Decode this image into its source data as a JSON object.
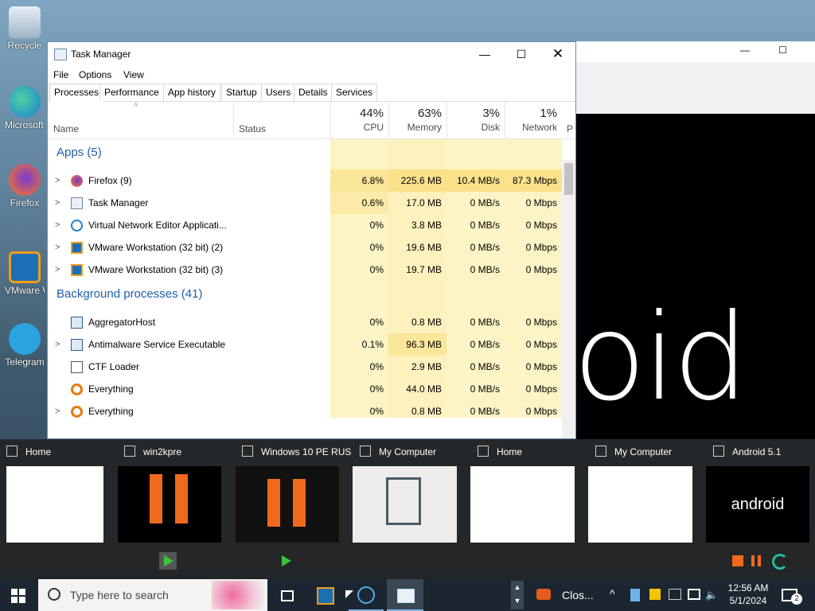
{
  "desktop": {
    "icons": [
      {
        "label": "Recycle"
      },
      {
        "label": "Microsoft Edge"
      },
      {
        "label": "Firefox"
      },
      {
        "label": "VMware Workstation"
      },
      {
        "label": "Telegram"
      }
    ]
  },
  "background_window": {
    "minimize": "—",
    "maximize": "☐",
    "big_text": "oid"
  },
  "task_manager": {
    "title": "Task Manager",
    "menu": [
      "File",
      "Options",
      "View"
    ],
    "tabs": [
      "Processes",
      "Performance",
      "App history",
      "Startup",
      "Users",
      "Details",
      "Services"
    ],
    "columns": {
      "name": "Name",
      "status": "Status",
      "cpu": {
        "pct": "44%",
        "label": "CPU"
      },
      "memory": {
        "pct": "63%",
        "label": "Memory"
      },
      "disk": {
        "pct": "3%",
        "label": "Disk"
      },
      "network": {
        "pct": "1%",
        "label": "Network"
      },
      "power": "P"
    },
    "apps_header": "Apps (5)",
    "apps": [
      {
        "name": "Firefox (9)",
        "cpu": "6.8%",
        "mem": "225.6 MB",
        "disk": "10.4 MB/s",
        "net": "87.3 Mbps"
      },
      {
        "name": "Task Manager",
        "cpu": "0.6%",
        "mem": "17.0 MB",
        "disk": "0 MB/s",
        "net": "0 Mbps"
      },
      {
        "name": "Virtual Network Editor Applicati...",
        "cpu": "0%",
        "mem": "3.8 MB",
        "disk": "0 MB/s",
        "net": "0 Mbps"
      },
      {
        "name": "VMware Workstation (32 bit) (2)",
        "cpu": "0%",
        "mem": "19.6 MB",
        "disk": "0 MB/s",
        "net": "0 Mbps"
      },
      {
        "name": "VMware Workstation (32 bit) (3)",
        "cpu": "0%",
        "mem": "19.7 MB",
        "disk": "0 MB/s",
        "net": "0 Mbps"
      }
    ],
    "bg_header": "Background processes (41)",
    "background": [
      {
        "name": "AggregatorHost",
        "cpu": "0%",
        "mem": "0.8 MB",
        "disk": "0 MB/s",
        "net": "0 Mbps"
      },
      {
        "name": "Antimalware Service Executable",
        "cpu": "0.1%",
        "mem": "96.3 MB",
        "disk": "0 MB/s",
        "net": "0 Mbps"
      },
      {
        "name": "CTF Loader",
        "cpu": "0%",
        "mem": "2.9 MB",
        "disk": "0 MB/s",
        "net": "0 Mbps"
      },
      {
        "name": "Everything",
        "cpu": "0%",
        "mem": "44.0 MB",
        "disk": "0 MB/s",
        "net": "0 Mbps"
      },
      {
        "name": "Everything",
        "cpu": "0%",
        "mem": "0.8 MB",
        "disk": "0 MB/s",
        "net": "0 Mbps"
      }
    ]
  },
  "previews": [
    {
      "label": "Home"
    },
    {
      "label": "win2kpre"
    },
    {
      "label": "Windows 10 PE RUS"
    },
    {
      "label": "My Computer"
    },
    {
      "label": "Home"
    },
    {
      "label": "My Computer"
    },
    {
      "label": "Android 5.1",
      "thumb_text": "android"
    }
  ],
  "taskbar": {
    "search_placeholder": "Type here to search",
    "notification_text": "Clos...",
    "time": "12:56 AM",
    "date": "5/1/2024",
    "action_center_count": "2"
  }
}
